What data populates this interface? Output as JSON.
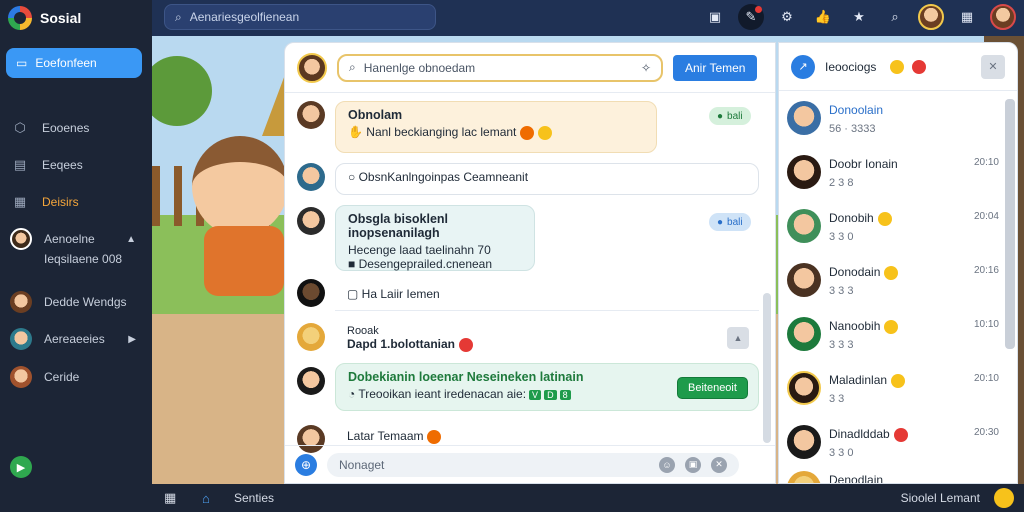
{
  "app": {
    "name": "Sosial"
  },
  "top_search": {
    "placeholder": "Aenariesgeolfienean"
  },
  "colors": {
    "accent": "#2a7de1",
    "sidebar": "#1c2536",
    "topbar": "#1f3154",
    "success": "#1e9b4b"
  },
  "sidebar": {
    "active_label": "Eoefonfeen",
    "items": [
      {
        "label": "Eooenes",
        "icon": "shield-icon"
      },
      {
        "label": "Eeqees",
        "icon": "list-icon"
      },
      {
        "label": "Deisirs",
        "icon": "calendar-icon"
      },
      {
        "label": "Aenoelne",
        "sub": "Ieqsilaene 008"
      },
      {
        "label": "Dedde Wendgs"
      },
      {
        "label": "Aereaeeies"
      },
      {
        "label": "Ceride"
      }
    ]
  },
  "chat": {
    "search_value": "Hanenlge obnoedam",
    "add_button": "Anir Temen",
    "messages": [
      {
        "title": "Obnolam",
        "body": "Nanl beckianging lac lemant",
        "tag": "bali"
      },
      {
        "body": "ObsnKanlngoinpas Ceamneanit"
      },
      {
        "title": "Obsgla bisoklenl inopsenanilagh",
        "line2": "Hecenge laad taelinahn 70",
        "line3": "Desengeprailed.cnenean",
        "tag": "bali"
      },
      {
        "body": "Ha Laiir Iemen"
      },
      {
        "title": "Rooak",
        "body": "Dapd 1.bolottanian"
      },
      {
        "title": "Dobekianin loeenar Neseineken latinain",
        "line2": "Treooikan ieant iredenacan aie:",
        "tags": [
          "V",
          "D",
          "8"
        ],
        "button": "Beiteneoit"
      },
      {
        "body": "Latar Temaam"
      }
    ],
    "composer_placeholder": "Nonaget"
  },
  "contacts": {
    "title": "Ieoociogs",
    "items": [
      {
        "name": "Donoolain",
        "meta": "56 · 3333"
      },
      {
        "name": "Doobr Ionain",
        "meta": "2 3 8",
        "time": "20:10"
      },
      {
        "name": "Donobih",
        "meta": "3 3 0",
        "time": "20:04"
      },
      {
        "name": "Donodain",
        "meta": "3 3 3",
        "time": "20:16"
      },
      {
        "name": "Nanoobih",
        "meta": "3 3 3",
        "time": "10:10"
      },
      {
        "name": "Maladinlan",
        "meta": "3 3",
        "time": "20:10"
      },
      {
        "name": "Dinadlddab",
        "meta": "3 3 0",
        "time": "20:30"
      },
      {
        "name": "Denodlain",
        "meta": "",
        "time": ""
      }
    ]
  },
  "bottombar": {
    "label": "Senties",
    "right": "Sioolel Lemant"
  }
}
